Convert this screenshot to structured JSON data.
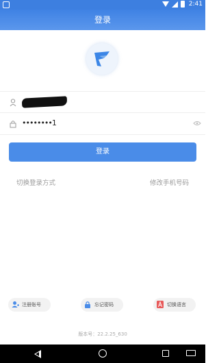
{
  "status_bar": {
    "time": "2:41"
  },
  "header": {
    "title": "登录"
  },
  "form": {
    "password_masked": "••••••••1"
  },
  "actions": {
    "login_label": "登录",
    "switch_login_method": "切换登录方式",
    "change_phone": "修改手机号码"
  },
  "bottom": {
    "register": "注册账号",
    "forgot_password": "忘记密码",
    "switch_language": "切换语言",
    "version": "版本号：22.2.25_630"
  },
  "colors": {
    "brand": "#4a8ce8",
    "header": "#3f82e4"
  },
  "icons": {
    "user": "user-icon",
    "lock": "lock-icon",
    "eye": "eye-icon"
  }
}
